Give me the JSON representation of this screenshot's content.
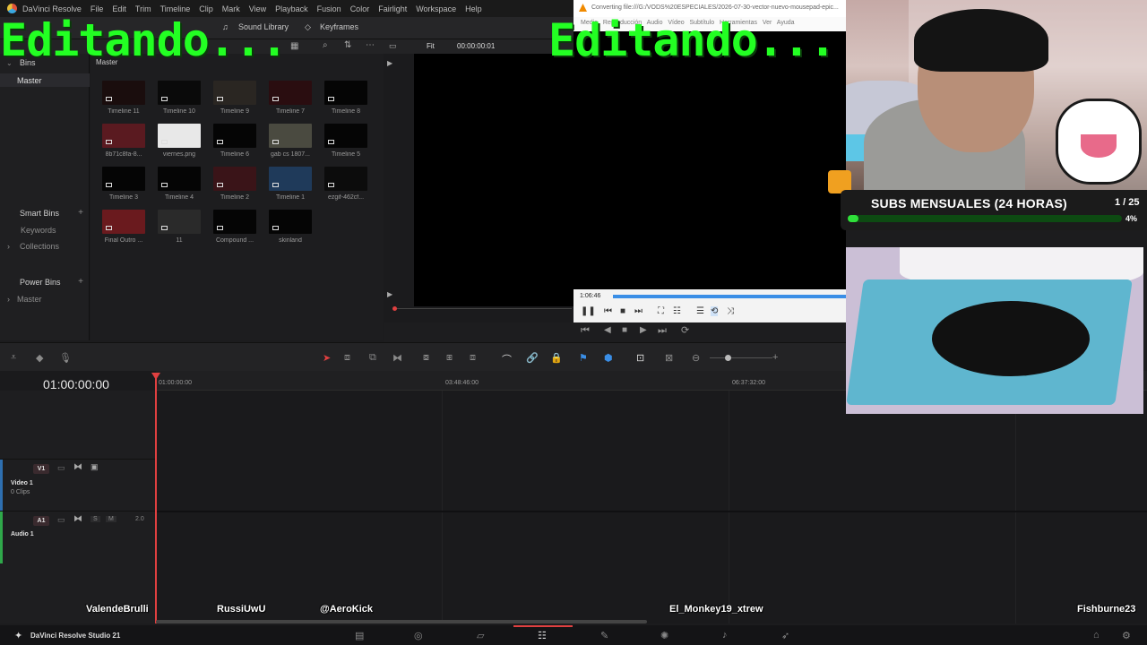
{
  "overlay": {
    "left_text": "Editando...",
    "right_text": "Editando..."
  },
  "menubar": {
    "app": "DaVinci Resolve",
    "items": [
      "File",
      "Edit",
      "Trim",
      "Timeline",
      "Clip",
      "Mark",
      "View",
      "Playback",
      "Fusion",
      "Color",
      "Fairlight",
      "Workspace",
      "Help"
    ]
  },
  "toolbar": {
    "sound_library": "Sound Library",
    "keyframes": "Keyframes"
  },
  "viewer": {
    "zoom": "Fit",
    "timecode": "00:00:00:01"
  },
  "bins": {
    "header": "Bins",
    "master": "Master",
    "smart_bins": "Smart Bins",
    "keywords": "Keywords",
    "collections": "Collections",
    "power_bins": "Power Bins",
    "power_master": "Master"
  },
  "pool": {
    "title": "Master",
    "clips": [
      "Timeline 11",
      "Timeline 10",
      "Timeline 9",
      "Timeline 7",
      "Timeline 8",
      "8b71c8fa-8...",
      "viernes.png",
      "Timeline 6",
      "gab cs 1807...",
      "Timeline 5",
      "Timeline 3",
      "Timeline 4",
      "Timeline 2",
      "Timeline 1",
      "ezgif-462cf...",
      "Final Outro ...",
      "11",
      "Compound ...",
      "skinland"
    ]
  },
  "vlc": {
    "title": "Converting file:///G:/VODS%20ESPECIALES/2026-07-30-vector-nuevo-mousepad-epic...",
    "menu": [
      "Medio",
      "Reproducción",
      "Audio",
      "Vídeo",
      "Subtítulo",
      "Herramientas",
      "Ver",
      "Ayuda"
    ],
    "time": "1:06:46"
  },
  "timeline": {
    "timecode": "01:00:00:00",
    "ruler": [
      "01:00:00:00",
      "03:48:46:00",
      "06:37:32:00"
    ],
    "video_track": {
      "badge": "V1",
      "name": "Video 1",
      "clips": "0 Clips"
    },
    "audio_track": {
      "badge": "A1",
      "name": "Audio 1",
      "level": "2.0",
      "s": "S",
      "m": "M"
    }
  },
  "subs_goal": {
    "title": "SUBS MENSUALES (24 HORAS)",
    "count": "1 / 25",
    "percent_label": "4%",
    "progress": 0.04
  },
  "chat_names": [
    "ValendeBrulli",
    "RussiUwU",
    "@AeroKick",
    "El_Monkey19_xtrew",
    "Fishburne23"
  ],
  "taskbar": {
    "app": "DaVinci Resolve Studio 21"
  },
  "colors": {
    "overlay_green": "#23ff23",
    "playhead": "#e04040",
    "vlc_seek": "#3a8ee6",
    "subs_green": "#2fe03a"
  }
}
